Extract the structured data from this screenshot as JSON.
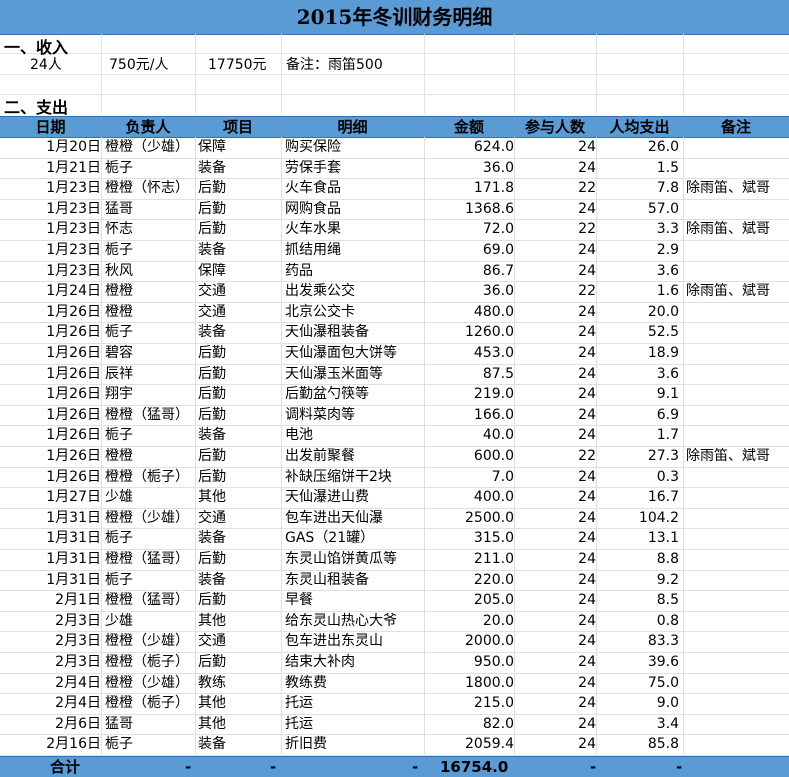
{
  "title": "2015年冬训财务明细",
  "income": {
    "heading": "一、收入",
    "people": "24人",
    "per_person": "750元/人",
    "total": "17750元",
    "note": "备注：雨笛500"
  },
  "expense": {
    "heading": "二、支出",
    "columns": [
      "日期",
      "负责人",
      "项目",
      "明细",
      "金额",
      "参与人数",
      "人均支出",
      "备注"
    ],
    "rows": [
      [
        "1月20日",
        "橙橙（少雄）",
        "保障",
        "购买保险",
        "624.0",
        "24",
        "26.0",
        ""
      ],
      [
        "1月21日",
        "栀子",
        "装备",
        "劳保手套",
        "36.0",
        "24",
        "1.5",
        ""
      ],
      [
        "1月23日",
        "橙橙（怀志）",
        "后勤",
        "火车食品",
        "171.8",
        "22",
        "7.8",
        "除雨笛、斌哥"
      ],
      [
        "1月23日",
        "猛哥",
        "后勤",
        "网购食品",
        "1368.6",
        "24",
        "57.0",
        ""
      ],
      [
        "1月23日",
        "怀志",
        "后勤",
        "火车水果",
        "72.0",
        "22",
        "3.3",
        "除雨笛、斌哥"
      ],
      [
        "1月23日",
        "栀子",
        "装备",
        "抓结用绳",
        "69.0",
        "24",
        "2.9",
        ""
      ],
      [
        "1月23日",
        "秋风",
        "保障",
        "药品",
        "86.7",
        "24",
        "3.6",
        ""
      ],
      [
        "1月24日",
        "橙橙",
        "交通",
        "出发乘公交",
        "36.0",
        "22",
        "1.6",
        "除雨笛、斌哥"
      ],
      [
        "1月26日",
        "橙橙",
        "交通",
        "北京公交卡",
        "480.0",
        "24",
        "20.0",
        ""
      ],
      [
        "1月26日",
        "栀子",
        "装备",
        "天仙瀑租装备",
        "1260.0",
        "24",
        "52.5",
        ""
      ],
      [
        "1月26日",
        "碧容",
        "后勤",
        "天仙瀑面包大饼等",
        "453.0",
        "24",
        "18.9",
        ""
      ],
      [
        "1月26日",
        "辰祥",
        "后勤",
        "天仙瀑玉米面等",
        "87.5",
        "24",
        "3.6",
        ""
      ],
      [
        "1月26日",
        "翔宇",
        "后勤",
        "后勤盆勺筷等",
        "219.0",
        "24",
        "9.1",
        ""
      ],
      [
        "1月26日",
        "橙橙（猛哥）",
        "后勤",
        "调料菜肉等",
        "166.0",
        "24",
        "6.9",
        ""
      ],
      [
        "1月26日",
        "栀子",
        "装备",
        "电池",
        "40.0",
        "24",
        "1.7",
        ""
      ],
      [
        "1月26日",
        "橙橙",
        "后勤",
        "出发前聚餐",
        "600.0",
        "22",
        "27.3",
        "除雨笛、斌哥"
      ],
      [
        "1月26日",
        "橙橙（栀子）",
        "后勤",
        "补缺压缩饼干2块",
        "7.0",
        "24",
        "0.3",
        ""
      ],
      [
        "1月27日",
        "少雄",
        "其他",
        "天仙瀑进山费",
        "400.0",
        "24",
        "16.7",
        ""
      ],
      [
        "1月31日",
        "橙橙（少雄）",
        "交通",
        "包车进出天仙瀑",
        "2500.0",
        "24",
        "104.2",
        ""
      ],
      [
        "1月31日",
        "栀子",
        "装备",
        "GAS（21罐）",
        "315.0",
        "24",
        "13.1",
        ""
      ],
      [
        "1月31日",
        "橙橙（猛哥）",
        "后勤",
        "东灵山馅饼黄瓜等",
        "211.0",
        "24",
        "8.8",
        ""
      ],
      [
        "1月31日",
        "栀子",
        "装备",
        "东灵山租装备",
        "220.0",
        "24",
        "9.2",
        ""
      ],
      [
        "2月1日",
        "橙橙（猛哥）",
        "后勤",
        "早餐",
        "205.0",
        "24",
        "8.5",
        ""
      ],
      [
        "2月3日",
        "少雄",
        "其他",
        "给东灵山热心大爷",
        "20.0",
        "24",
        "0.8",
        ""
      ],
      [
        "2月3日",
        "橙橙（少雄）",
        "交通",
        "包车进出东灵山",
        "2000.0",
        "24",
        "83.3",
        ""
      ],
      [
        "2月3日",
        "橙橙（栀子）",
        "后勤",
        "结束大补肉",
        "950.0",
        "24",
        "39.6",
        ""
      ],
      [
        "2月4日",
        "橙橙（少雄）",
        "教练",
        "教练费",
        "1800.0",
        "24",
        "75.0",
        ""
      ],
      [
        "2月4日",
        "橙橙（栀子）",
        "其他",
        "托运",
        "215.0",
        "24",
        "9.0",
        ""
      ],
      [
        "2月6日",
        "猛哥",
        "其他",
        "托运",
        "82.0",
        "24",
        "3.4",
        ""
      ],
      [
        "2月16日",
        "栀子",
        "装备",
        "折旧费",
        "2059.4",
        "24",
        "85.8",
        ""
      ]
    ]
  },
  "total_row": {
    "label": "合计",
    "dash": "-",
    "amount": "16754.0"
  }
}
